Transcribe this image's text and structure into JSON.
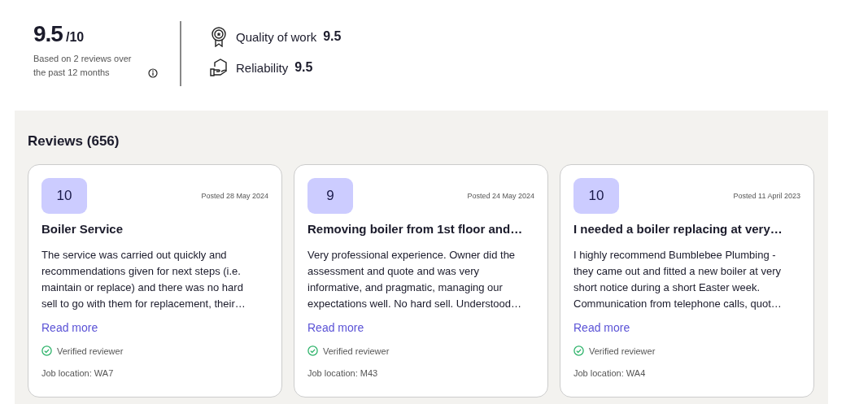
{
  "summary": {
    "score": "9.5",
    "out_of": "/10",
    "basis": "Based on 2 reviews over the past 12 months"
  },
  "ratings": [
    {
      "kind": "quality",
      "label": "Quality of work",
      "value": "9.5"
    },
    {
      "kind": "reliability",
      "label": "Reliability",
      "value": "9.5"
    }
  ],
  "reviews_heading": "Reviews (656)",
  "reviews": [
    {
      "score": "10",
      "posted": "Posted 28 May 2024",
      "title": "Boiler Service",
      "body_lines": [
        "The service was carried out quickly and",
        "recommendations given for next steps (i.e.",
        "maintain or replace) and there was no hard",
        "sell to go with them for replacement, their…"
      ],
      "read_more": "Read more",
      "verified": true,
      "verified_label": "Verified reviewer",
      "location": "Job location: WA7"
    },
    {
      "score": "9",
      "posted": "Posted 24 May 2024",
      "title": "Removing boiler from 1st floor and…",
      "body_lines": [
        "Very professional experience. Owner did the",
        "assessment and quote and was very",
        "informative, and pragmatic, managing our",
        "expectations well. No hard sell. Understood…"
      ],
      "read_more": "Read more",
      "verified": true,
      "verified_label": "Verified reviewer",
      "location": "Job location: M43"
    },
    {
      "score": "10",
      "posted": "Posted 11 April 2023",
      "title": "I needed a boiler replacing at very…",
      "body_lines": [
        "I highly recommend Bumblebee Plumbing -",
        "they came out and fitted a new boiler at very",
        "short notice during a short Easter week.",
        "Communication from telephone calls, quot…"
      ],
      "read_more": "Read more",
      "verified": true,
      "verified_label": "Verified reviewer",
      "location": "Job location: WA4"
    }
  ]
}
